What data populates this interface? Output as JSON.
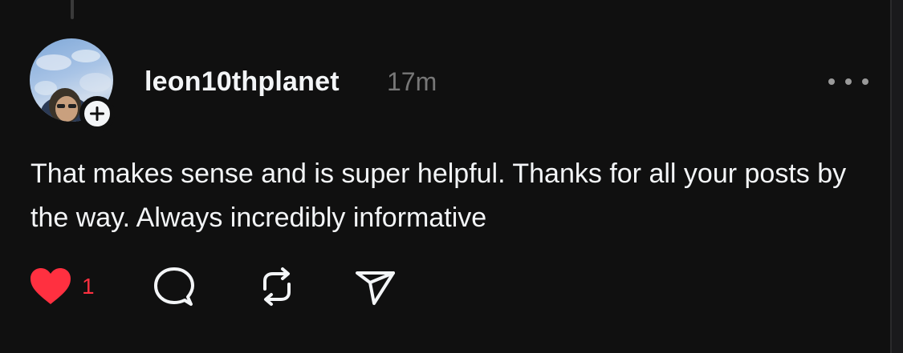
{
  "post": {
    "username": "leon10thplanet",
    "timestamp": "17m",
    "body": "That makes sense and is super helpful. Thanks for all your posts by the way. Always incredibly informative",
    "likes": "1",
    "liked": true
  },
  "icons": {
    "more": "more-horizontal-icon",
    "follow": "plus-icon",
    "like": "heart-filled-icon",
    "reply": "comment-icon",
    "repost": "repost-icon",
    "share": "send-icon"
  },
  "colors": {
    "background": "#101010",
    "text": "#f3f5f7",
    "muted": "#777777",
    "like": "#ff3040"
  }
}
